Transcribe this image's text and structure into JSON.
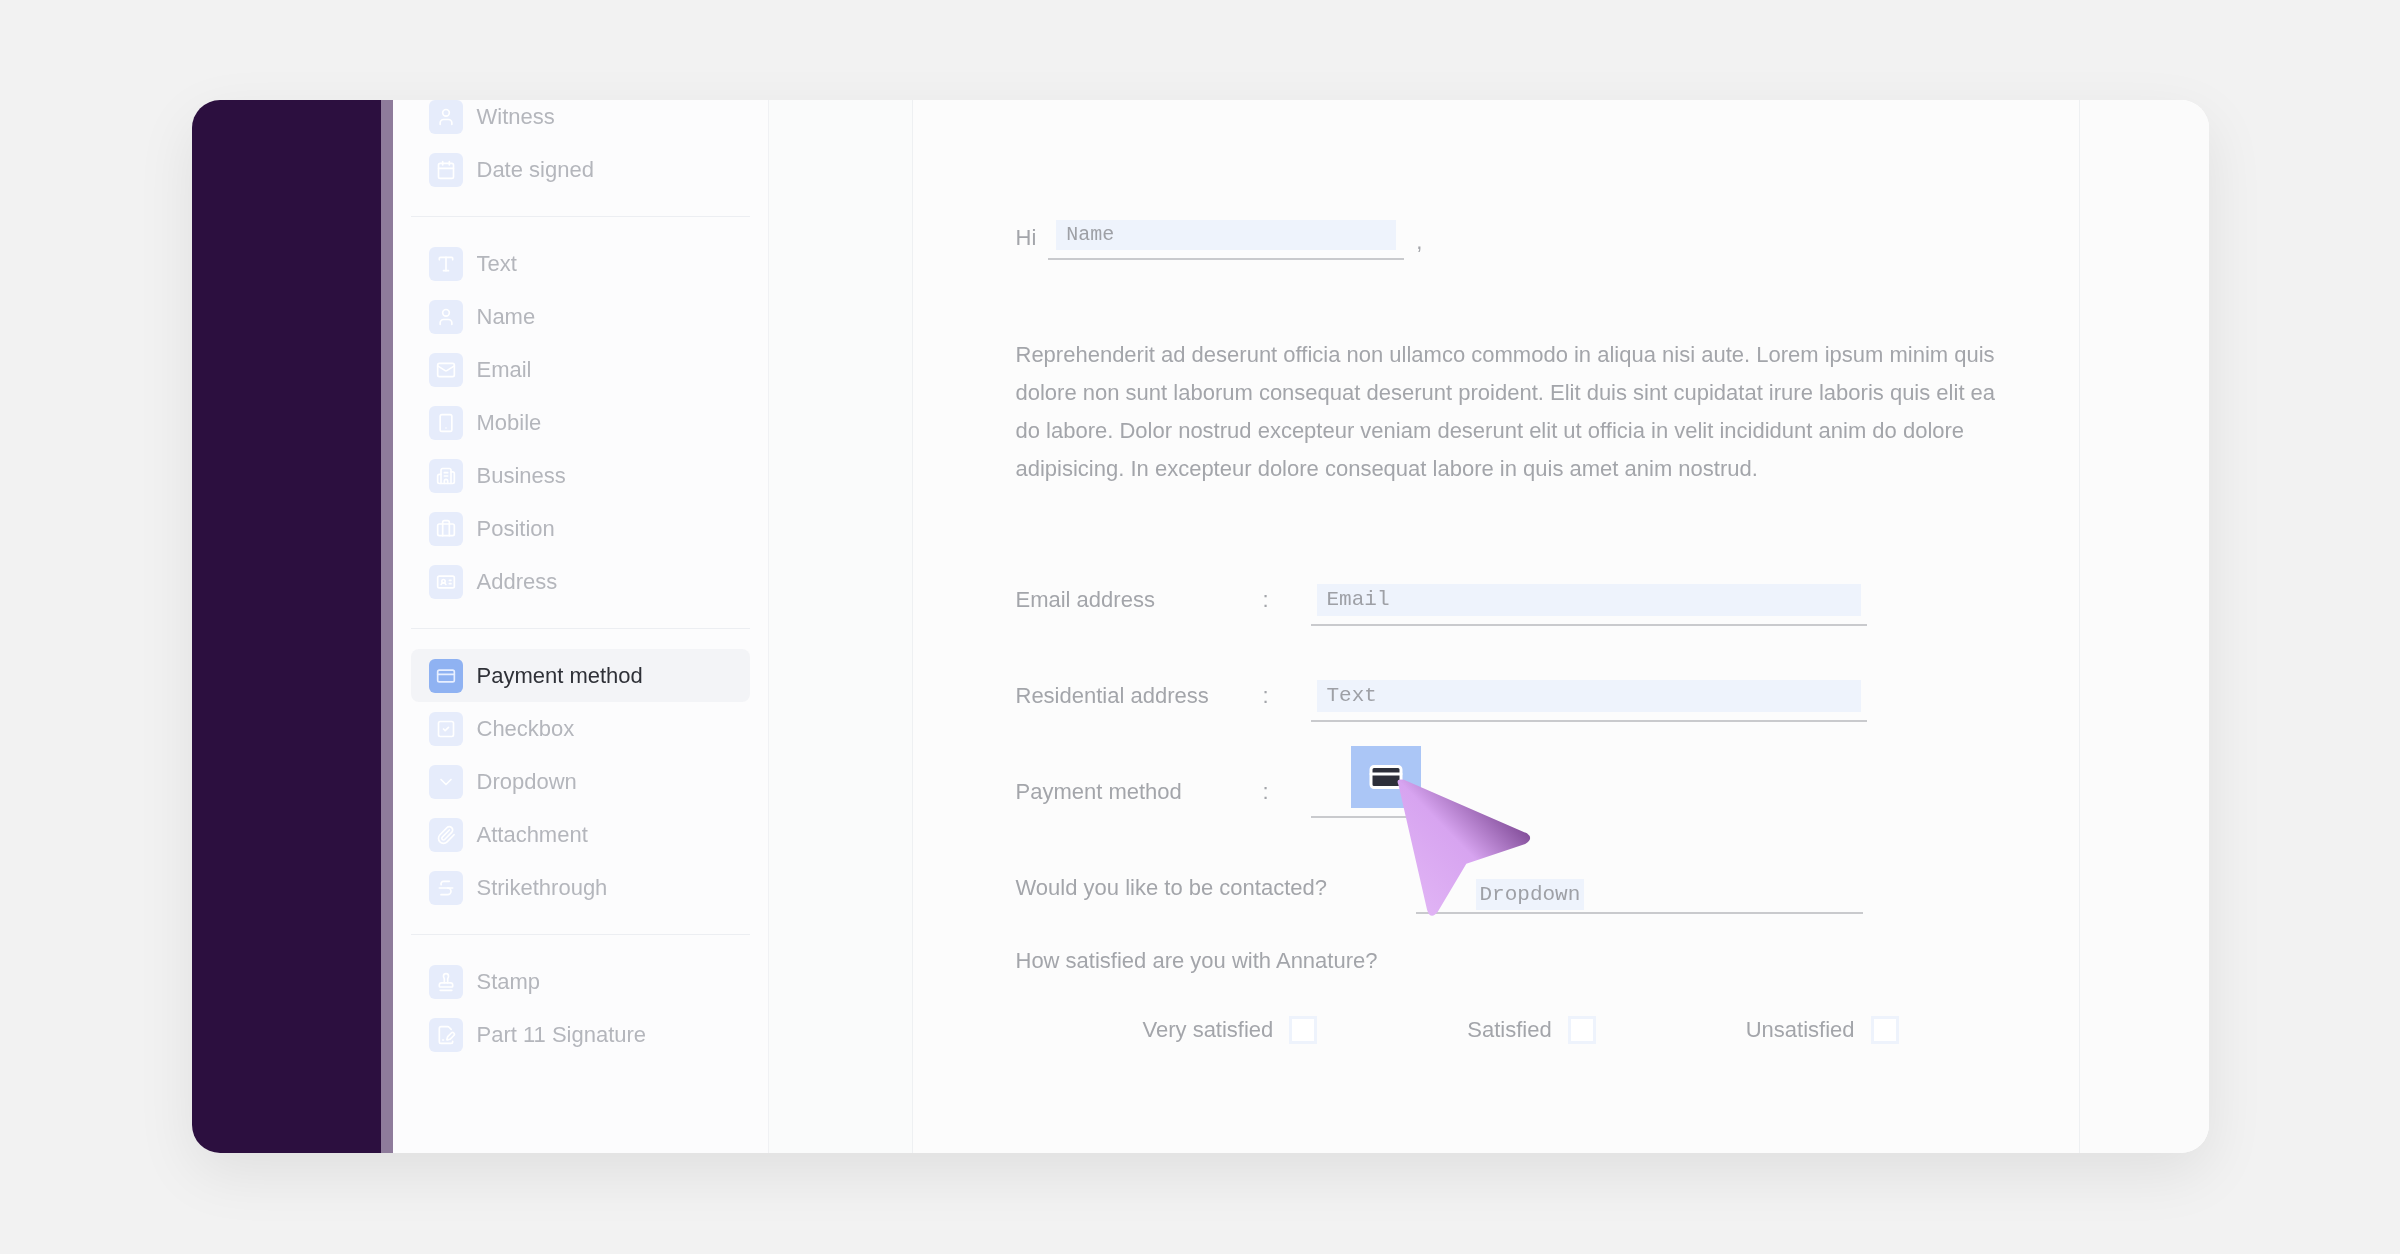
{
  "sidebar": {
    "groups": [
      {
        "items": [
          {
            "label": "Witness",
            "selected": false
          },
          {
            "label": "Date signed",
            "selected": false
          }
        ]
      },
      {
        "items": [
          {
            "label": "Text",
            "selected": false
          },
          {
            "label": "Name",
            "selected": false
          },
          {
            "label": "Email",
            "selected": false
          },
          {
            "label": "Mobile",
            "selected": false
          },
          {
            "label": "Business",
            "selected": false
          },
          {
            "label": "Position",
            "selected": false
          },
          {
            "label": "Address",
            "selected": false
          }
        ]
      },
      {
        "items": [
          {
            "label": "Payment method",
            "selected": true
          },
          {
            "label": "Checkbox",
            "selected": false
          },
          {
            "label": "Dropdown",
            "selected": false
          },
          {
            "label": "Attachment",
            "selected": false
          },
          {
            "label": "Strikethrough",
            "selected": false
          }
        ]
      },
      {
        "items": [
          {
            "label": "Stamp",
            "selected": false
          },
          {
            "label": "Part 11 Signature",
            "selected": false
          }
        ]
      }
    ]
  },
  "document": {
    "greeting": "Hi",
    "name_field": {
      "placeholder": "Name"
    },
    "comma": ",",
    "paragraph": "Reprehenderit ad deserunt officia non ullamco commodo in aliqua nisi aute. Lorem ipsum minim quis dolore non sunt laborum consequat deserunt proident. Elit duis sint cupidatat irure laboris quis elit ea do labore. Dolor nostrud excepteur veniam deserunt elit ut officia in velit incididunt anim do dolore adipisicing. In excepteur dolore consequat labore in quis amet anim nostrud.",
    "rows": [
      {
        "kind": "text",
        "label": "Email address",
        "colon": ":",
        "placeholder": "Email"
      },
      {
        "kind": "text",
        "label": "Residential address",
        "colon": ":",
        "placeholder": "Text"
      },
      {
        "kind": "payment",
        "label": "Payment method",
        "colon": ":"
      },
      {
        "kind": "dropdown",
        "label": "Would you like to be contacted?",
        "placeholder": "Dropdown"
      }
    ],
    "question": "How satisfied are you with Annature?",
    "options": [
      {
        "label": "Very satisfied",
        "checked": false
      },
      {
        "label": "Satisfied",
        "checked": false
      },
      {
        "label": "Unsatisfied",
        "checked": false
      }
    ]
  }
}
